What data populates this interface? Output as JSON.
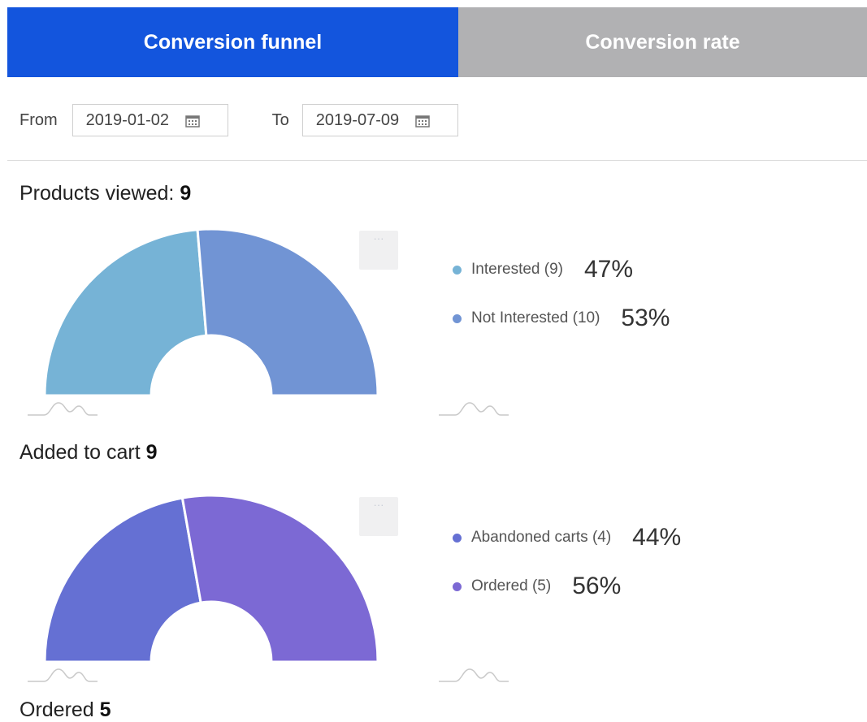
{
  "tabs": [
    {
      "label": "Conversion funnel",
      "active": true,
      "color": "#1355dd"
    },
    {
      "label": "Conversion rate",
      "active": false,
      "color": "#b1b1b3"
    }
  ],
  "filters": {
    "from_label": "From",
    "from_value": "2019-01-02",
    "to_label": "To",
    "to_value": "2019-07-09"
  },
  "sections": [
    {
      "label": "Products viewed:",
      "value": "9"
    },
    {
      "label": "Added to cart",
      "value": "9"
    },
    {
      "label": "Ordered",
      "value": "5"
    }
  ],
  "menu_glyph": "···",
  "chart_data": [
    {
      "type": "pie",
      "title": "Products viewed",
      "shape": "half-donut",
      "series": [
        {
          "name": "Interested (9)",
          "value": 9,
          "percent": "47%",
          "color": "#76b3d6"
        },
        {
          "name": "Not Interested (10)",
          "value": 10,
          "percent": "53%",
          "color": "#7194d4"
        }
      ]
    },
    {
      "type": "pie",
      "title": "Added to cart",
      "shape": "half-donut",
      "series": [
        {
          "name": "Abandoned carts (4)",
          "value": 4,
          "percent": "44%",
          "color": "#6570d3"
        },
        {
          "name": "Ordered (5)",
          "value": 5,
          "percent": "56%",
          "color": "#7c69d4"
        }
      ]
    }
  ]
}
